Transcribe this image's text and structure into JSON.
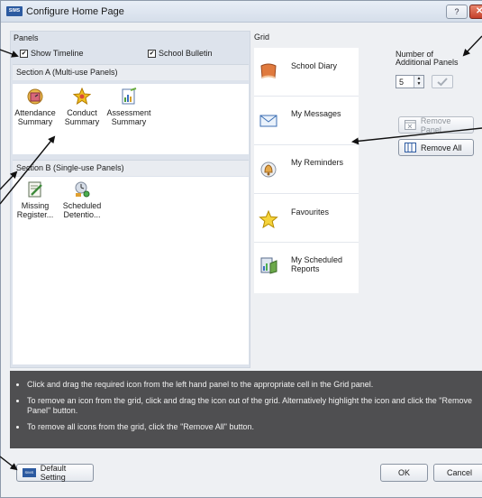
{
  "window": {
    "title": "Configure Home Page",
    "app_icon_text": "SIMS",
    "help_label": "?",
    "close_label": "✕"
  },
  "panels": {
    "label": "Panels",
    "show_timeline": {
      "label": "Show Timeline",
      "checked": true
    },
    "school_bulletin": {
      "label": "School Bulletin",
      "checked": true
    },
    "section_a": {
      "title": "Section A (Multi-use Panels)",
      "items": [
        {
          "line1": "Attendance",
          "line2": "Summary",
          "icon": "clock-calendar-icon"
        },
        {
          "line1": "Conduct",
          "line2": "Summary",
          "icon": "star-award-icon"
        },
        {
          "line1": "Assessment",
          "line2": "Summary",
          "icon": "document-chart-icon"
        }
      ]
    },
    "section_b": {
      "title": "Section B (Single-use Panels)",
      "items": [
        {
          "line1": "Missing",
          "line2": "Register...",
          "icon": "register-pencil-icon"
        },
        {
          "line1": "Scheduled",
          "line2": "Detentio...",
          "icon": "scheduled-detention-icon"
        }
      ]
    }
  },
  "grid": {
    "label": "Grid",
    "cells": [
      {
        "line1": "School Diary",
        "line2": "",
        "icon": "diary-book-icon"
      },
      {
        "line1": "My Messages",
        "line2": "",
        "icon": "envelope-icon"
      },
      {
        "line1": "My Reminders",
        "line2": "",
        "icon": "reminder-bell-icon"
      },
      {
        "line1": "Favourites",
        "line2": "",
        "icon": "star-icon"
      },
      {
        "line1": "My Scheduled",
        "line2": "Reports",
        "icon": "report-chart-icon"
      }
    ]
  },
  "controls": {
    "number_label_line1": "Number of",
    "number_label_line2": "Additional Panels",
    "number_value": "5",
    "remove_panel_label": "Remove Panel",
    "remove_all_label": "Remove All"
  },
  "info": {
    "lines": [
      "Click and drag the required icon from the left hand panel to the appropriate cell in the Grid panel.",
      "To remove an icon from the grid, click and drag the icon out of the grid. Alternatively highlight the icon and click  the  \"Remove Panel\" button.",
      "To remove all icons from the grid, click the \"Remove All\" button."
    ]
  },
  "footer": {
    "default_setting_label": "Default Setting",
    "ok_label": "OK",
    "cancel_label": "Cancel"
  },
  "colors": {
    "panel_bg": "#dde3ec",
    "info_bg": "#4f4f51",
    "accent": "#2c5aa0"
  }
}
